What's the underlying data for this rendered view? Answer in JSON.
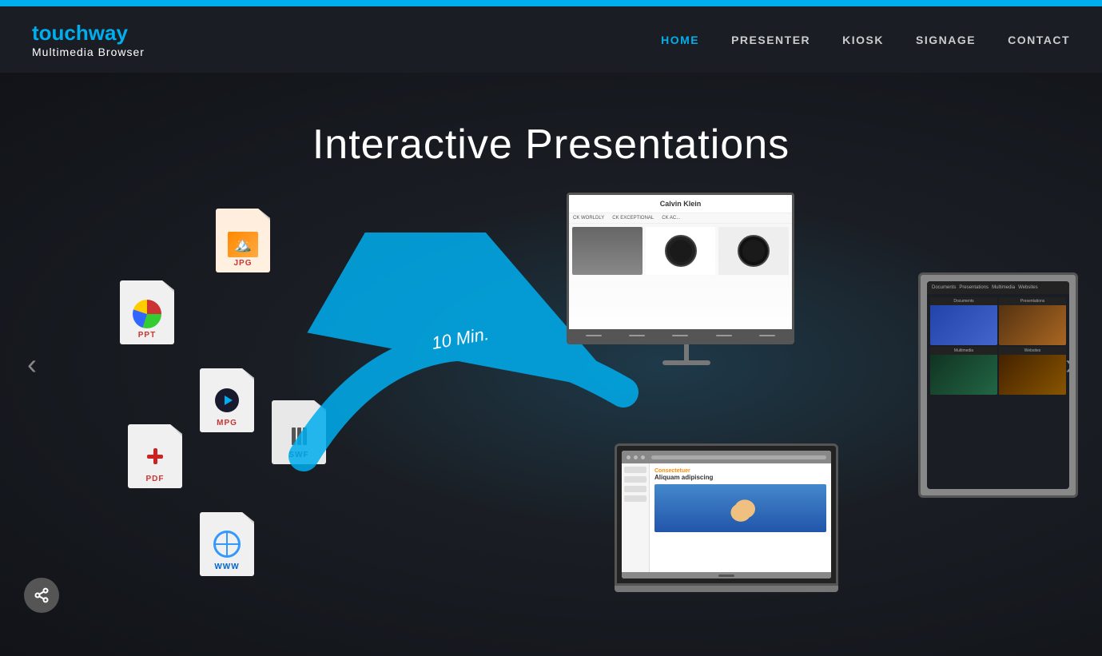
{
  "topBar": {
    "color": "#00aeef"
  },
  "header": {
    "logo": {
      "brand": "touch",
      "brandAccent": "way",
      "subtitle": "Multimedia Browser"
    },
    "nav": {
      "items": [
        {
          "id": "home",
          "label": "HOME",
          "active": true
        },
        {
          "id": "presenter",
          "label": "PRESENTER",
          "active": false
        },
        {
          "id": "kiosk",
          "label": "KIOSK",
          "active": false
        },
        {
          "id": "signage",
          "label": "SIGNAGE",
          "active": false
        },
        {
          "id": "contact",
          "label": "CONTACT",
          "active": false
        }
      ]
    }
  },
  "hero": {
    "title": "Interactive Presentations",
    "arrowLabel": "10 Min.",
    "fileIcons": [
      {
        "id": "ppt",
        "label": "PPT",
        "labelColor": "#cc3333"
      },
      {
        "id": "jpg",
        "label": "JPG",
        "labelColor": "#cc3333"
      },
      {
        "id": "mpg",
        "label": "MPG",
        "labelColor": "#cc3333"
      },
      {
        "id": "pdf",
        "label": "PDF",
        "labelColor": "#cc3333"
      },
      {
        "id": "swf",
        "label": "SWF",
        "labelColor": "#333333"
      },
      {
        "id": "www",
        "label": "WWW",
        "labelColor": "#1166cc"
      }
    ],
    "devices": {
      "monitor": {
        "brand": "Calvin Klein",
        "products": [
          "CK WORLDLY",
          "CK EXCEPTIONAL",
          "CK AC..."
        ]
      },
      "laptop": {
        "headline": "Consectetuer",
        "text": "Aliquam adipiscing"
      },
      "tablet": {
        "tabs": [
          "Documents",
          "Presentations",
          "Multimedia",
          "Websites"
        ]
      }
    }
  },
  "share": {
    "label": "share"
  },
  "carousel": {
    "prevLabel": "‹",
    "nextLabel": "›"
  }
}
